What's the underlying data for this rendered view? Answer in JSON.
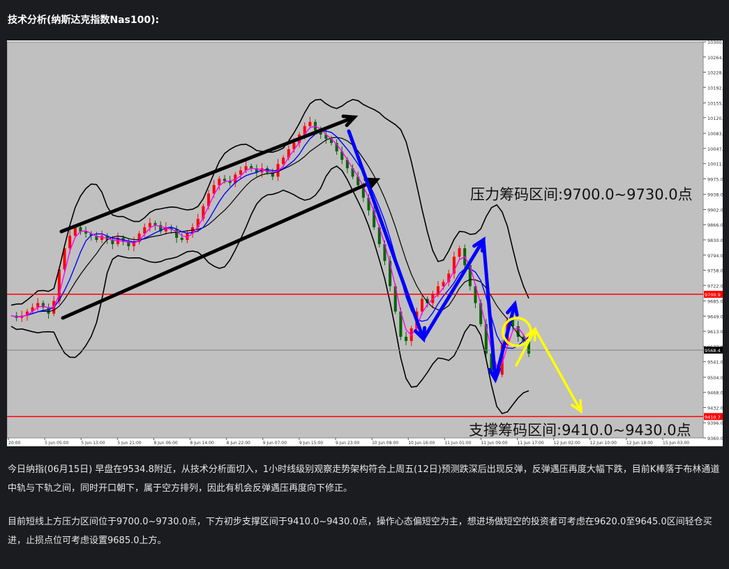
{
  "heading": "技术分析(纳斯达克指数Nas100):",
  "paragraphs": [
    "今日纳指(06月15日) 早盘在9534.8附近，从技术分析面切入，1小时线级别观察走势架构符合上周五(12日)预测跌深后出现反弹，反弹遇压再度大幅下跌，目前K棒落于布林通道中轨与下轨之间，同时开口朝下，属于空方排列，因此有机会反弹遇压再度向下修正。",
    "目前短线上方压力区间位于9700.0~9730.0点，下方初步支撑区间于9410.0~9430.0点，操作心态偏短空为主，想进场做短空的投资者可考虑在9620.0至9645.0区间轻仓买进，止损点位可考虑设置9685.0上方。"
  ],
  "colors": {
    "plot_bg": "#c0c0c0",
    "bull": "#ff0000",
    "bear": "#006400",
    "bollinger": "#000000",
    "ma_fast": "#ff00ff",
    "ma_slow": "#0000ff",
    "level_line": "#ff0000",
    "arrow_black": "#000000",
    "arrow_blue": "#0000ff",
    "arrow_yellow": "#ffff00"
  },
  "chart_data": {
    "type": "candlestick",
    "ylim": [
      9360,
      10300
    ],
    "y_ticks": [
      "10300.0",
      "10264.0",
      "10228.0",
      "10192.0",
      "10155.0",
      "10120.0",
      "10083.0",
      "10047.0",
      "10011.0",
      "9975.0",
      "9938.0",
      "9902.0",
      "9866.0",
      "9830.0",
      "9794.0",
      "9758.0",
      "9722.0",
      "9685.0",
      "9649.0",
      "9613.0",
      "9577.0",
      "9541.0",
      "9504.0",
      "9468.0",
      "9432.0",
      "9396.0",
      "9360.0"
    ],
    "x_ticks": [
      "20:00",
      "5 Jun 05:00",
      "5 Jun 13:00",
      "5 Jun 21:00",
      "8 Jun 06:00",
      "8 Jun 14:00",
      "8 Jun 22:00",
      "9 Jun 07:00",
      "9 Jun 15:00",
      "9 Jun 23:00",
      "10 Jun 08:00",
      "10 Jun 16:00",
      "11 Jun 01:00",
      "11 Jun 09:00",
      "11 Jun 17:00",
      "12 Jun 02:00",
      "12 Jun 10:00",
      "12 Jun 18:00",
      "15 Jun 03:00"
    ],
    "close_path": [
      9650,
      9645,
      9650,
      9660,
      9670,
      9680,
      9670,
      9655,
      9685,
      9760,
      9810,
      9840,
      9860,
      9850,
      9845,
      9840,
      9830,
      9840,
      9830,
      9820,
      9835,
      9825,
      9815,
      9825,
      9845,
      9860,
      9870,
      9865,
      9850,
      9860,
      9855,
      9835,
      9830,
      9845,
      9860,
      9880,
      9910,
      9940,
      9960,
      9975,
      9970,
      9965,
      9985,
      9995,
      10005,
      10000,
      9990,
      10000,
      9990,
      9980,
      10010,
      10025,
      10045,
      10060,
      10080,
      10100,
      10110,
      10090,
      10080,
      10070,
      10060,
      10040,
      10020,
      10000,
      9980,
      9960,
      9930,
      9900,
      9860,
      9820,
      9780,
      9720,
      9660,
      9600,
      9590,
      9620,
      9660,
      9690,
      9680,
      9700,
      9720,
      9730,
      9750,
      9790,
      9810,
      9770,
      9720,
      9680,
      9630,
      9560,
      9520,
      9510,
      9580,
      9640,
      9625,
      9600,
      9590,
      9560
    ],
    "lines": {
      "resistance": {
        "value": 9700.9,
        "label": "9700.9"
      },
      "support": {
        "value": 9410.7,
        "label": "9410.7"
      },
      "current": {
        "value": 9568.4,
        "label": "9568.4"
      }
    },
    "annotations": {
      "resistance_text": "压力筹码区间:9700.0~9730.0点",
      "support_text": "支撑筹码区间:9410.0~9430.0点"
    }
  }
}
